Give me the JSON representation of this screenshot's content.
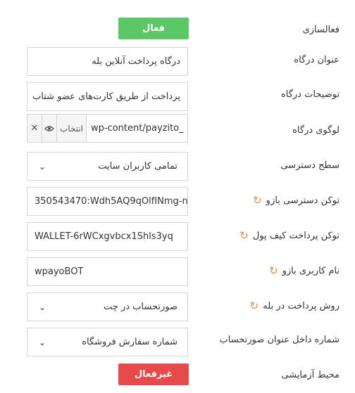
{
  "settings": {
    "activation": {
      "label": "فعالسازی",
      "button": "فعال",
      "color": "#5cc767"
    },
    "gateway_title": {
      "label": "عنوان درگاه",
      "value": "درگاه پرداخت آنلاین بله"
    },
    "gateway_description": {
      "label": "توضیحات درگاه",
      "value": "پرداخت از طریق کارت‌های عضو شتاب"
    },
    "gateway_logo": {
      "label": "لوگوی درگاه",
      "value": "wp-content/payzito_",
      "select_label": "انتخاب",
      "view_icon": "eye-icon",
      "clear_icon": "close-icon"
    },
    "access_level": {
      "label": "سطح دسترسی",
      "value": "تمامی کاربران سایت"
    },
    "bot_access_token": {
      "label": "توکن دسترسی بازو",
      "value": "350543470:Wdh5AQ9qOlfINmg-n",
      "icon": "refresh-icon"
    },
    "wallet_payment_token": {
      "label": "توکن پرداخت کیف پول",
      "value": "WALLET-6rWCxgvbcx1Shls3yq",
      "icon": "refresh-icon"
    },
    "bot_username": {
      "label": "نام کاربری بازو",
      "value": "wpayoBOT",
      "icon": "refresh-icon"
    },
    "payment_method": {
      "label": "روش پرداخت در بله",
      "value": "صورتحساب در چت",
      "icon": "refresh-icon"
    },
    "invoice_title_number": {
      "label": "شماره داخل عنوان صورتحساب",
      "value": "شماره سفارش فروشگاه"
    },
    "sandbox": {
      "label": "محیط آزمایشی",
      "button": "غیرفعال",
      "color": "#e74a4a"
    }
  }
}
